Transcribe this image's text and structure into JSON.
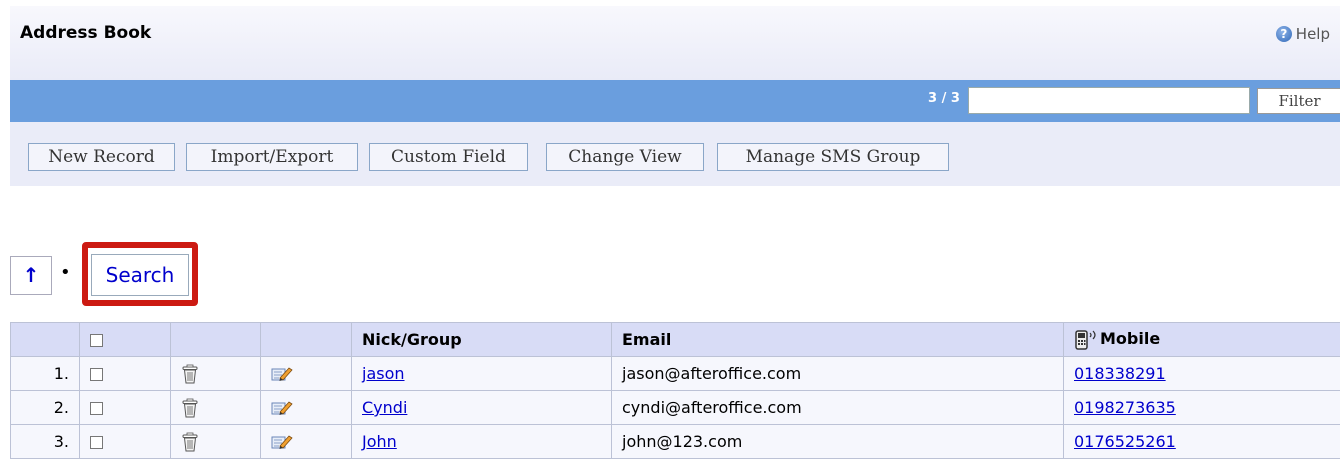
{
  "header": {
    "title": "Address Book",
    "help_label": "Help"
  },
  "filter_bar": {
    "count": "3 / 3",
    "filter_value": "",
    "filter_button": "Filter"
  },
  "toolbar": {
    "buttons": [
      "New Record",
      "Import/Export",
      "Custom Field",
      "Change View",
      "Manage SMS Group"
    ]
  },
  "nav": {
    "up_label": "↑",
    "separator": "•",
    "search_label": "Search",
    "highlight_color": "#cc1a12"
  },
  "table": {
    "columns": [
      "",
      "",
      "",
      "",
      "Nick/Group",
      "Email",
      "Mobile"
    ],
    "rows": [
      {
        "index": "1.",
        "nick": "jason",
        "email": "jason@afteroffice.com",
        "mobile": "018338291"
      },
      {
        "index": "2.",
        "nick": "Cyndi",
        "email": "cyndi@afteroffice.com",
        "mobile": "0198273635"
      },
      {
        "index": "3.",
        "nick": "John",
        "email": "john@123.com",
        "mobile": "0176525261"
      }
    ]
  },
  "icons": {
    "help": "help-icon",
    "delete": "trash-icon",
    "edit": "edit-icon",
    "mobile": "mobile-phone-icon"
  },
  "colors": {
    "bluebar": "#6a9ede",
    "link": "#0000cc",
    "header_row": "#d8dcf6"
  }
}
